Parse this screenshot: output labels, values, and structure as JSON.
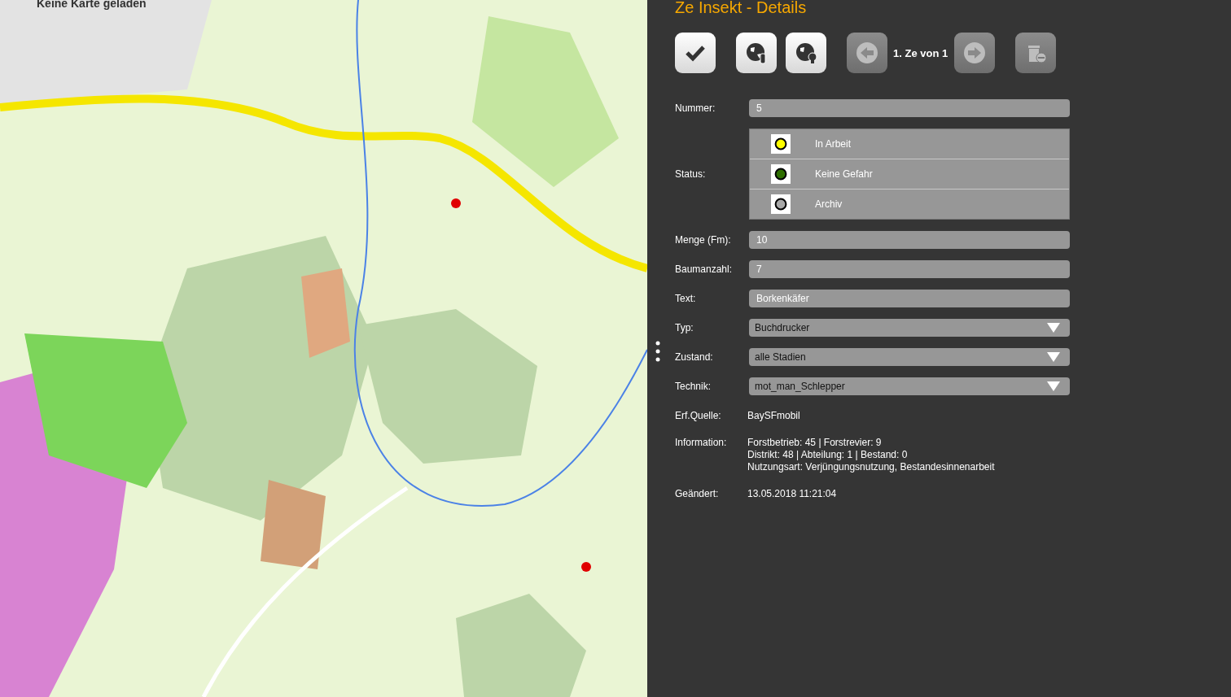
{
  "map": {
    "notice": "Keine Karte geladen"
  },
  "panel": {
    "title": "Ze Insekt - Details",
    "toolbar": [
      {
        "kind": "check",
        "disabled": false
      },
      {
        "kind": "globe-hand",
        "disabled": false
      },
      {
        "kind": "globe-bulb",
        "disabled": false
      },
      {
        "kind": "prev",
        "disabled": true
      },
      {
        "kind": "counter",
        "label": "1. Ze von 1"
      },
      {
        "kind": "next",
        "disabled": true
      },
      {
        "kind": "delete",
        "disabled": true
      }
    ],
    "fields": [
      {
        "kind": "input",
        "label": "Nummer:",
        "value": "5"
      },
      {
        "kind": "status",
        "label": "Status:",
        "options": [
          {
            "label": "In Arbeit",
            "color": "#ffff00"
          },
          {
            "label": "Keine Gefahr",
            "color": "#2e6e00"
          },
          {
            "label": "Archiv",
            "color": "#a8a8a8"
          }
        ]
      },
      {
        "kind": "input",
        "label": "Menge (Fm):",
        "value": "10"
      },
      {
        "kind": "input",
        "label": "Baumanzahl:",
        "value": "7"
      },
      {
        "kind": "input",
        "label": "Text:",
        "value": "Borkenkäfer"
      },
      {
        "kind": "select",
        "label": "Typ:",
        "value": "Buchdrucker"
      },
      {
        "kind": "select",
        "label": "Zustand:",
        "value": "alle Stadien"
      },
      {
        "kind": "select",
        "label": "Technik:",
        "value": "mot_man_Schlepper"
      },
      {
        "kind": "text",
        "label": "Erf.Quelle:",
        "lines": [
          "BaySFmobil"
        ]
      },
      {
        "kind": "text",
        "label": "Information:",
        "lines": [
          "Forstbetrieb: 45 | Forstrevier: 9",
          "Distrikt: 48 | Abteilung: 1 | Bestand: 0",
          "Nutzungsart: Verjüngungsnutzung, Bestandesinnenarbeit"
        ]
      },
      {
        "kind": "text",
        "label": "Geändert:",
        "lines": [
          "13.05.2018 11:21:04"
        ]
      }
    ]
  }
}
